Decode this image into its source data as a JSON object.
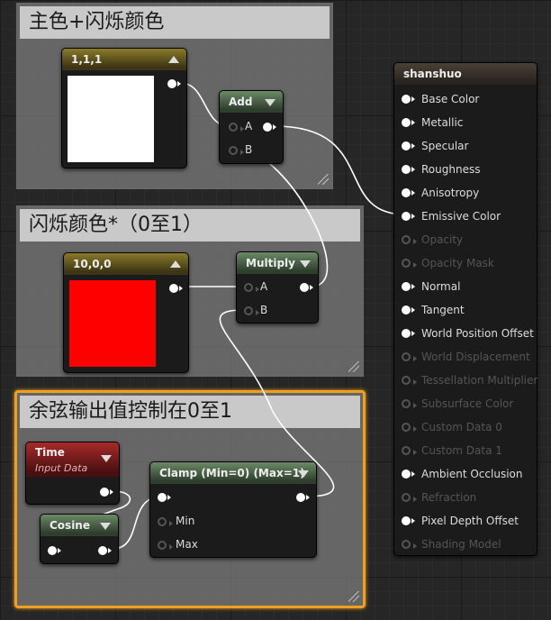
{
  "comments": {
    "main": "主色+闪烁颜色",
    "flash": "闪烁颜色*（0至1）",
    "sine": "余弦输出值控制在0至1"
  },
  "nodes": {
    "const_white": {
      "title": "1,1,1",
      "color": "#ffffff"
    },
    "add": {
      "title": "Add",
      "pin_a": "A",
      "pin_b": "B"
    },
    "const_red": {
      "title": "10,0,0",
      "color": "#ff0000"
    },
    "multiply": {
      "title": "Multiply",
      "pin_a": "A",
      "pin_b": "B"
    },
    "time": {
      "title": "Time",
      "subtitle": "Input Data"
    },
    "cosine": {
      "title": "Cosine"
    },
    "clamp": {
      "title": "Clamp (Min=0) (Max=1)",
      "pin_min": "Min",
      "pin_max": "Max"
    }
  },
  "result": {
    "title": "shanshuo",
    "pins": [
      {
        "label": "Base Color",
        "enabled": true
      },
      {
        "label": "Metallic",
        "enabled": true
      },
      {
        "label": "Specular",
        "enabled": true
      },
      {
        "label": "Roughness",
        "enabled": true
      },
      {
        "label": "Anisotropy",
        "enabled": true
      },
      {
        "label": "Emissive Color",
        "enabled": true,
        "connected": true
      },
      {
        "label": "Opacity",
        "enabled": false
      },
      {
        "label": "Opacity Mask",
        "enabled": false
      },
      {
        "label": "Normal",
        "enabled": true
      },
      {
        "label": "Tangent",
        "enabled": true
      },
      {
        "label": "World Position Offset",
        "enabled": true
      },
      {
        "label": "World Displacement",
        "enabled": false
      },
      {
        "label": "Tessellation Multiplier",
        "enabled": false
      },
      {
        "label": "Subsurface Color",
        "enabled": false
      },
      {
        "label": "Custom Data 0",
        "enabled": false
      },
      {
        "label": "Custom Data 1",
        "enabled": false
      },
      {
        "label": "Ambient Occlusion",
        "enabled": true
      },
      {
        "label": "Refraction",
        "enabled": false
      },
      {
        "label": "Pixel Depth Offset",
        "enabled": true
      },
      {
        "label": "Shading Model",
        "enabled": false
      }
    ]
  },
  "colors": {
    "selection": "#f0a020",
    "wire": "#ffffff"
  }
}
